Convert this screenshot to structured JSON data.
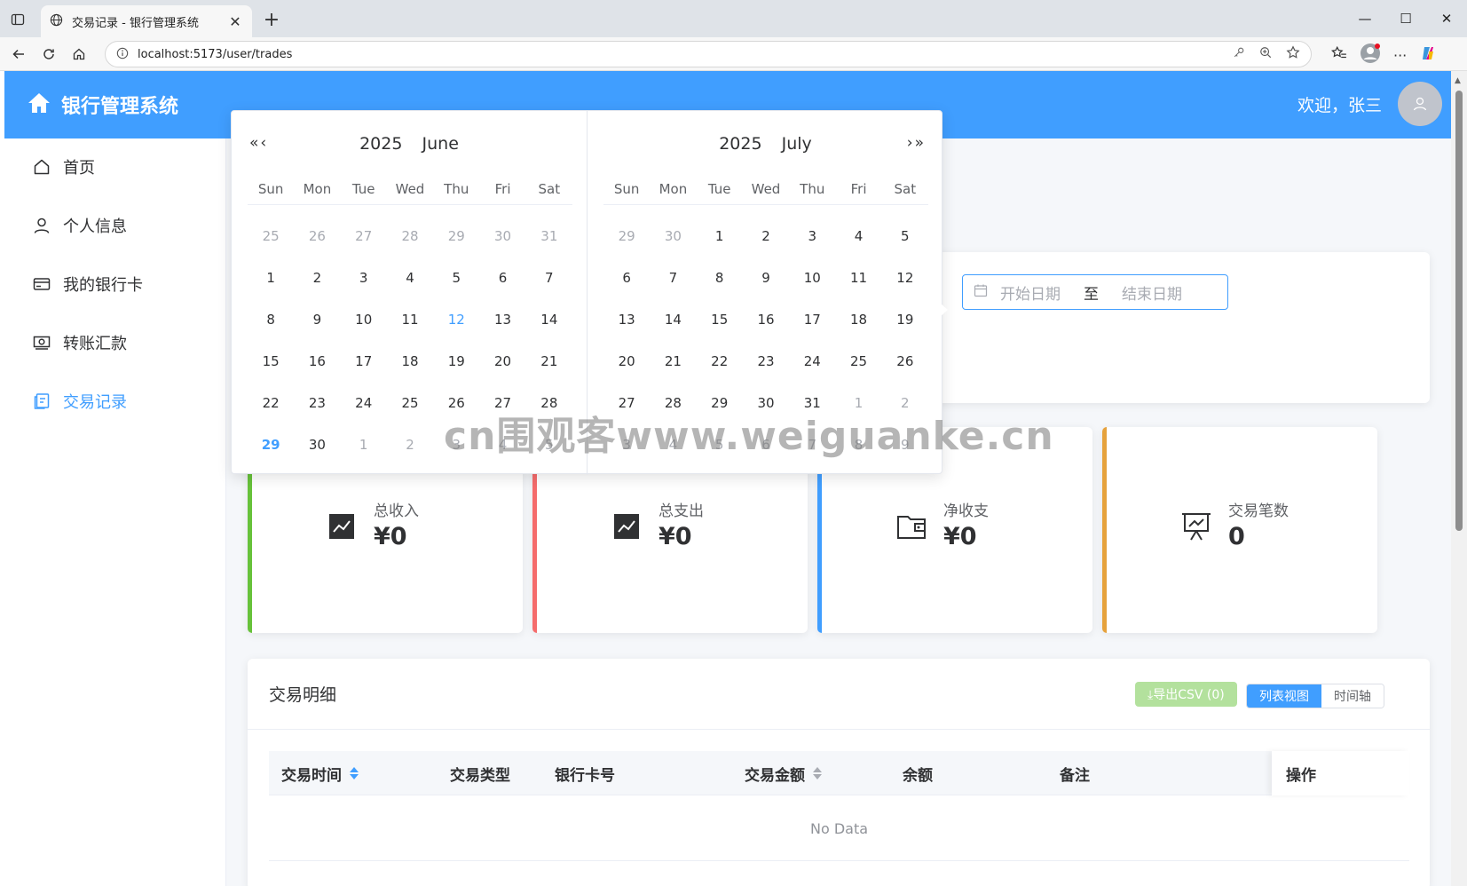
{
  "browser": {
    "tab_title": "交易记录 - 银行管理系统",
    "url": "localhost:5173/user/trades"
  },
  "header": {
    "app_title": "银行管理系统",
    "welcome": "欢迎，张三"
  },
  "sidebar": {
    "items": [
      {
        "label": "首页",
        "icon": "home-icon"
      },
      {
        "label": "个人信息",
        "icon": "user-icon"
      },
      {
        "label": "我的银行卡",
        "icon": "card-icon"
      },
      {
        "label": "转账汇款",
        "icon": "transfer-icon"
      },
      {
        "label": "交易记录",
        "icon": "document-icon",
        "active": true
      }
    ]
  },
  "filter": {
    "start_placeholder": "开始日期",
    "separator": "至",
    "end_placeholder": "结束日期"
  },
  "stats": [
    {
      "label": "总收入",
      "value": "¥0",
      "color": "#67c23a",
      "icon": "trend-icon"
    },
    {
      "label": "总支出",
      "value": "¥0",
      "color": "#f56c6c",
      "icon": "trend-icon"
    },
    {
      "label": "净收支",
      "value": "¥0",
      "color": "#409eff",
      "icon": "wallet-icon"
    },
    {
      "label": "交易笔数",
      "value": "0",
      "color": "#e6a23c",
      "icon": "presentation-icon"
    }
  ],
  "details": {
    "title": "交易明细",
    "export_label": "⤓导出CSV (0)",
    "view_list": "列表视图",
    "view_timeline": "时间轴",
    "columns": [
      "交易时间",
      "交易类型",
      "银行卡号",
      "交易金额",
      "余额",
      "备注",
      "操作"
    ],
    "empty_text": "No Data"
  },
  "datepicker": {
    "weekdays": [
      "Sun",
      "Mon",
      "Tue",
      "Wed",
      "Thu",
      "Fri",
      "Sat"
    ],
    "left": {
      "year": "2025",
      "month": "June",
      "nav": "«‹",
      "rows": [
        [
          "25",
          "26",
          "27",
          "28",
          "29",
          "30",
          "31"
        ],
        [
          "1",
          "2",
          "3",
          "4",
          "5",
          "6",
          "7"
        ],
        [
          "8",
          "9",
          "10",
          "11",
          "12",
          "13",
          "14"
        ],
        [
          "15",
          "16",
          "17",
          "18",
          "19",
          "20",
          "21"
        ],
        [
          "22",
          "23",
          "24",
          "25",
          "26",
          "27",
          "28"
        ],
        [
          "29",
          "30",
          "1",
          "2",
          "3",
          "4",
          "5"
        ]
      ]
    },
    "right": {
      "year": "2025",
      "month": "July",
      "nav": "›»",
      "rows": [
        [
          "29",
          "30",
          "1",
          "2",
          "3",
          "4",
          "5"
        ],
        [
          "6",
          "7",
          "8",
          "9",
          "10",
          "11",
          "12"
        ],
        [
          "13",
          "14",
          "15",
          "16",
          "17",
          "18",
          "19"
        ],
        [
          "20",
          "21",
          "22",
          "23",
          "24",
          "25",
          "26"
        ],
        [
          "27",
          "28",
          "29",
          "30",
          "31",
          "1",
          "2"
        ],
        [
          "3",
          "4",
          "5",
          "6",
          "7",
          "8",
          "9"
        ]
      ]
    }
  },
  "watermark": "cn围观客www.weiguanke.cn"
}
